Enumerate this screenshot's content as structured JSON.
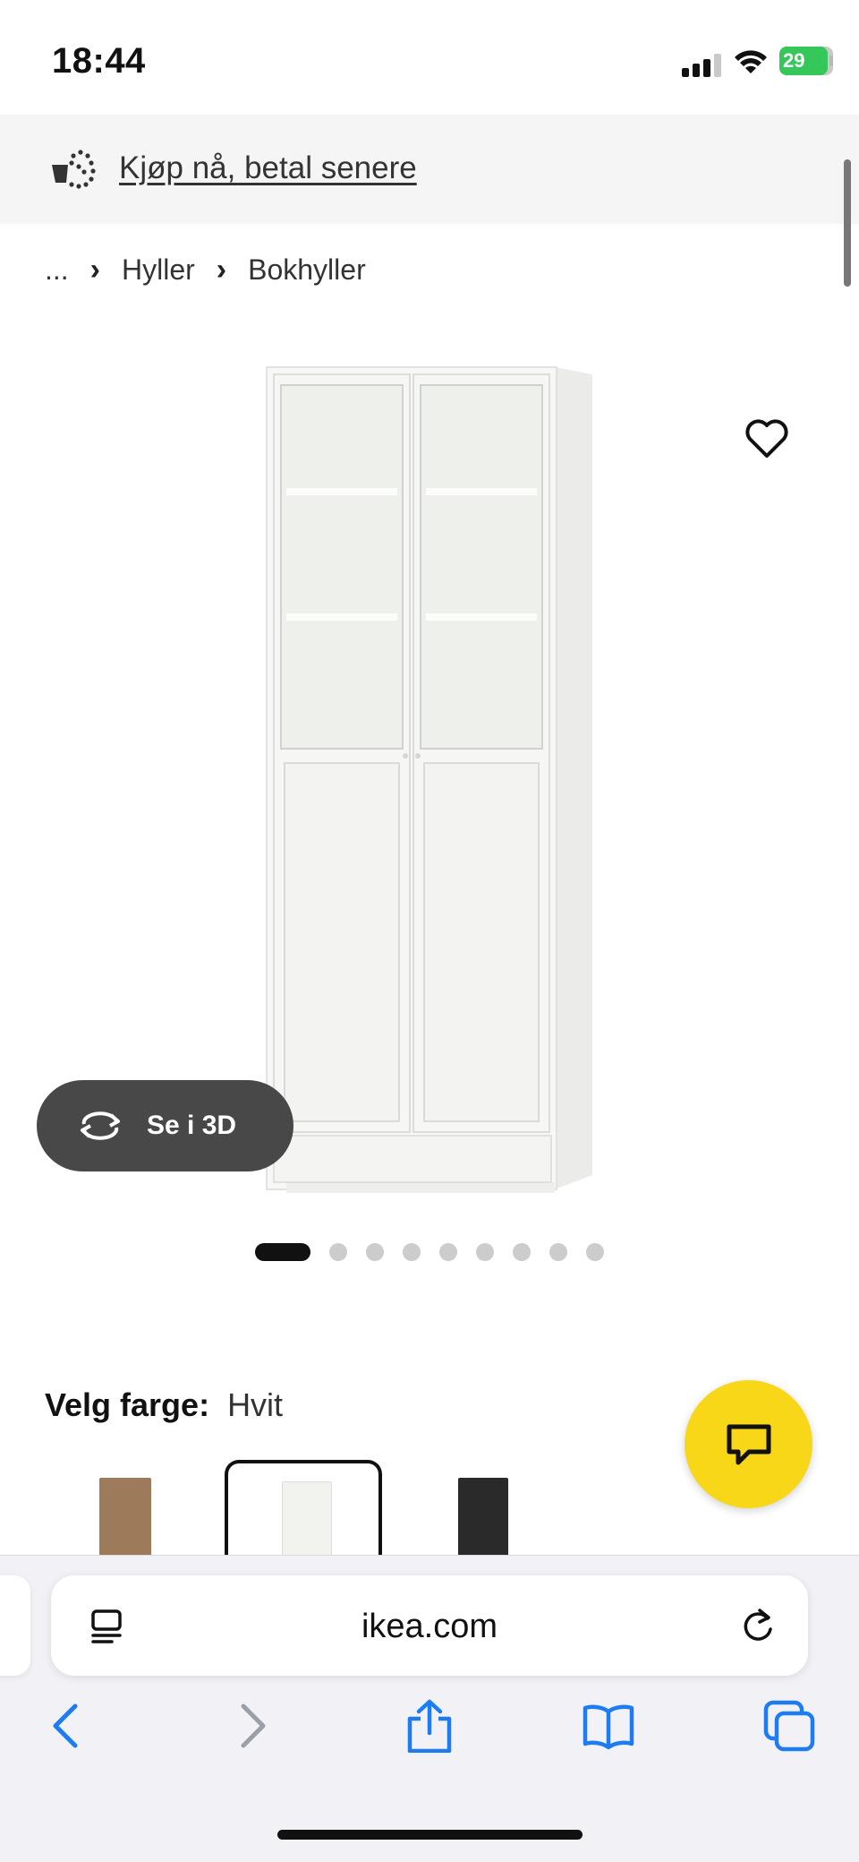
{
  "status_bar": {
    "time": "18:44",
    "battery_level": "29",
    "signal_icon": "cellular-signal-icon",
    "wifi_icon": "wifi-icon",
    "battery_icon": "battery-charging-icon"
  },
  "promo": {
    "icon": "pay-later-basket-icon",
    "text": "Kjøp nå, betal senere"
  },
  "breadcrumb": {
    "items": [
      "...",
      "Hyller",
      "Bokhyller"
    ]
  },
  "product": {
    "image_icon": "bookcase-glass-doors-image",
    "favorite_icon": "heart-icon",
    "see_3d_label": "Se i 3D",
    "see_3d_icon": "rotate-3d-icon",
    "carousel": {
      "total": 9,
      "active": 1
    }
  },
  "color_select": {
    "label": "Velg farge:",
    "value": "Hvit",
    "swatches": [
      {
        "name": "brown-oak",
        "color": "#9c7a5a",
        "selected": false
      },
      {
        "name": "white",
        "color": "#f2f2ef",
        "selected": true
      },
      {
        "name": "black",
        "color": "#2a2a2a",
        "selected": false
      }
    ]
  },
  "chat": {
    "icon": "chat-bubble-icon",
    "color": "#f8d718"
  },
  "browser": {
    "url": "ikea.com",
    "reader_icon": "reader-mode-icon",
    "reload_icon": "reload-icon",
    "toolbar": [
      "back-icon",
      "forward-icon",
      "share-icon",
      "bookmarks-icon",
      "tabs-icon"
    ],
    "accent": "#1e7cf2"
  }
}
